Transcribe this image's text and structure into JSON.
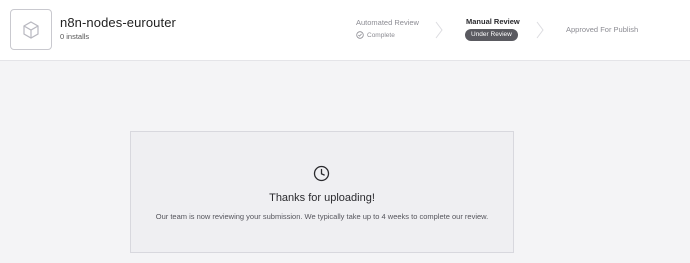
{
  "package": {
    "name": "n8n-nodes-eurouter",
    "installs": "0 installs"
  },
  "steps": [
    {
      "title": "Automated Review",
      "status": "Complete"
    },
    {
      "title": "Manual Review",
      "status": "Under Review"
    },
    {
      "title": "Approved For Publish"
    }
  ],
  "card": {
    "title": "Thanks for uploading!",
    "message": "Our team is now reviewing your submission. We typically take up to 4 weeks to complete our review."
  },
  "icons": {
    "package": "cube-icon",
    "complete": "check-circle-icon",
    "separator": "chevron-right-icon",
    "pending": "clock-icon"
  }
}
